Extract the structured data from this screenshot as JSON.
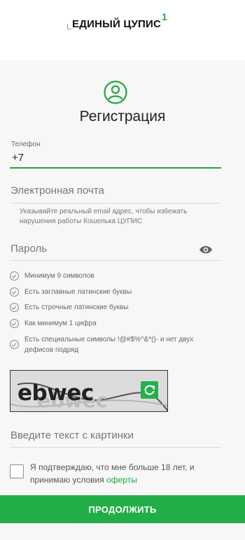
{
  "header": {
    "logo_text": "ЕДИНЫЙ ЦУПИС",
    "logo_superscript": "1"
  },
  "form": {
    "title": "Регистрация",
    "phone": {
      "label": "Телефон",
      "value": "+7"
    },
    "email": {
      "placeholder": "Электронная почта",
      "hint": "Указывайте реальный email адрес, чтобы избежать нарушения работы Кошелька ЦУПИС"
    },
    "password": {
      "placeholder": "Пароль",
      "requirements": [
        "Минимум 9 символов",
        "Есть заглавные латинские буквы",
        "Есть строчные латинские буквы",
        "Как минимум 1 цифра",
        "Есть специальные символы !@#$%^&*()- и нет двух дефисов подряд"
      ]
    },
    "captcha": {
      "image_text": "ebwec",
      "input_placeholder": "Введите текст с картинки"
    },
    "agreement": {
      "text": "Я подтверждаю, что мне больше 18 лет, и принимаю условия ",
      "link": "оферты"
    },
    "submit_label": "ПРОДОЛЖИТЬ"
  },
  "colors": {
    "accent": "#23ad48",
    "background": "#f7f7f7"
  },
  "icons": [
    "user-circle-icon",
    "eye-icon",
    "check-circle-icon",
    "refresh-icon"
  ]
}
